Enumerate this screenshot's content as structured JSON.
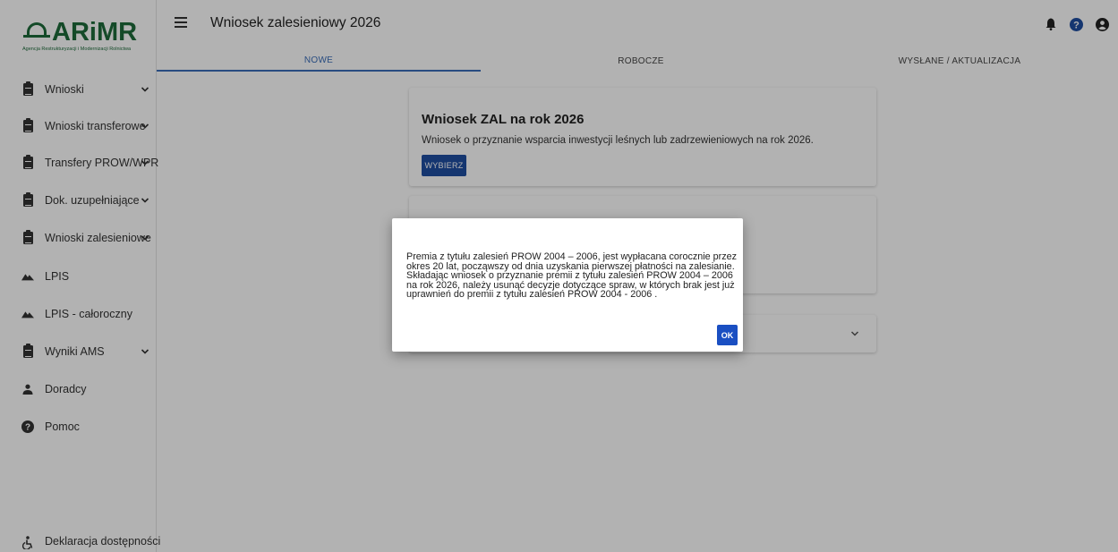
{
  "logo": {
    "name": "ARiMR",
    "subtitle": "Agencja Restrukturyzacji i Modernizacji Rolnictwa"
  },
  "header": {
    "title": "Wniosek zalesieniowy 2026",
    "icons": [
      "bell-icon",
      "help-icon",
      "account-icon"
    ]
  },
  "tabs": [
    {
      "label": "NOWE",
      "active": true
    },
    {
      "label": "ROBOCZE",
      "active": false
    },
    {
      "label": "WYSŁANE / AKTUALIZACJA",
      "active": false
    }
  ],
  "sidebar": {
    "items": [
      {
        "label": "Wnioski",
        "icon": "clipboard-icon",
        "expandable": true
      },
      {
        "label": "Wnioski transferowe",
        "icon": "clipboard-icon",
        "expandable": true
      },
      {
        "label": "Transfery PROW/WPR",
        "icon": "clipboard-icon",
        "expandable": true
      },
      {
        "label": "Dok. uzupełniające",
        "icon": "clipboard-icon",
        "expandable": true
      },
      {
        "label": "Wnioski zalesieniowe",
        "icon": "clipboard-icon",
        "expandable": true
      },
      {
        "label": "LPIS",
        "icon": "terrain-icon",
        "expandable": false
      },
      {
        "label": "LPIS - całoroczny",
        "icon": "terrain-icon",
        "expandable": false
      },
      {
        "label": "Wyniki AMS",
        "icon": "clipboard-icon",
        "expandable": true
      },
      {
        "label": "Doradcy",
        "icon": "person-icon",
        "expandable": false
      },
      {
        "label": "Pomoc",
        "icon": "help-icon",
        "expandable": false
      }
    ],
    "footer_label": "Deklaracja dostępności"
  },
  "main": {
    "card1": {
      "title": "Wniosek ZAL na rok 2026",
      "description": "Wniosek o przyznanie wsparcia inwestycji leśnych lub zadrzewieniowych na rok 2026.",
      "button": "WYBIERZ"
    }
  },
  "dialog": {
    "lines": [
      "Premia z tytułu zalesień PROW 2004 – 2006, jest wypłacana corocznie przez",
      "okres 20 lat, począwszy od dnia uzyskania pierwszej płatności na zalesianie.",
      "Składając wniosek o przyznanie premii z tytułu zalesień PROW 2004 – 2006",
      "na rok 2026, należy usunąć decyzje dotyczące spraw, w których brak jest już",
      "uprawnień do premii z tytułu zalesień PROW 2004 - 2006 ."
    ],
    "ok_label": "OK"
  },
  "colors": {
    "brand": "#1d6b3a",
    "accent": "#3a6db8",
    "button": "#1f4ea1"
  }
}
